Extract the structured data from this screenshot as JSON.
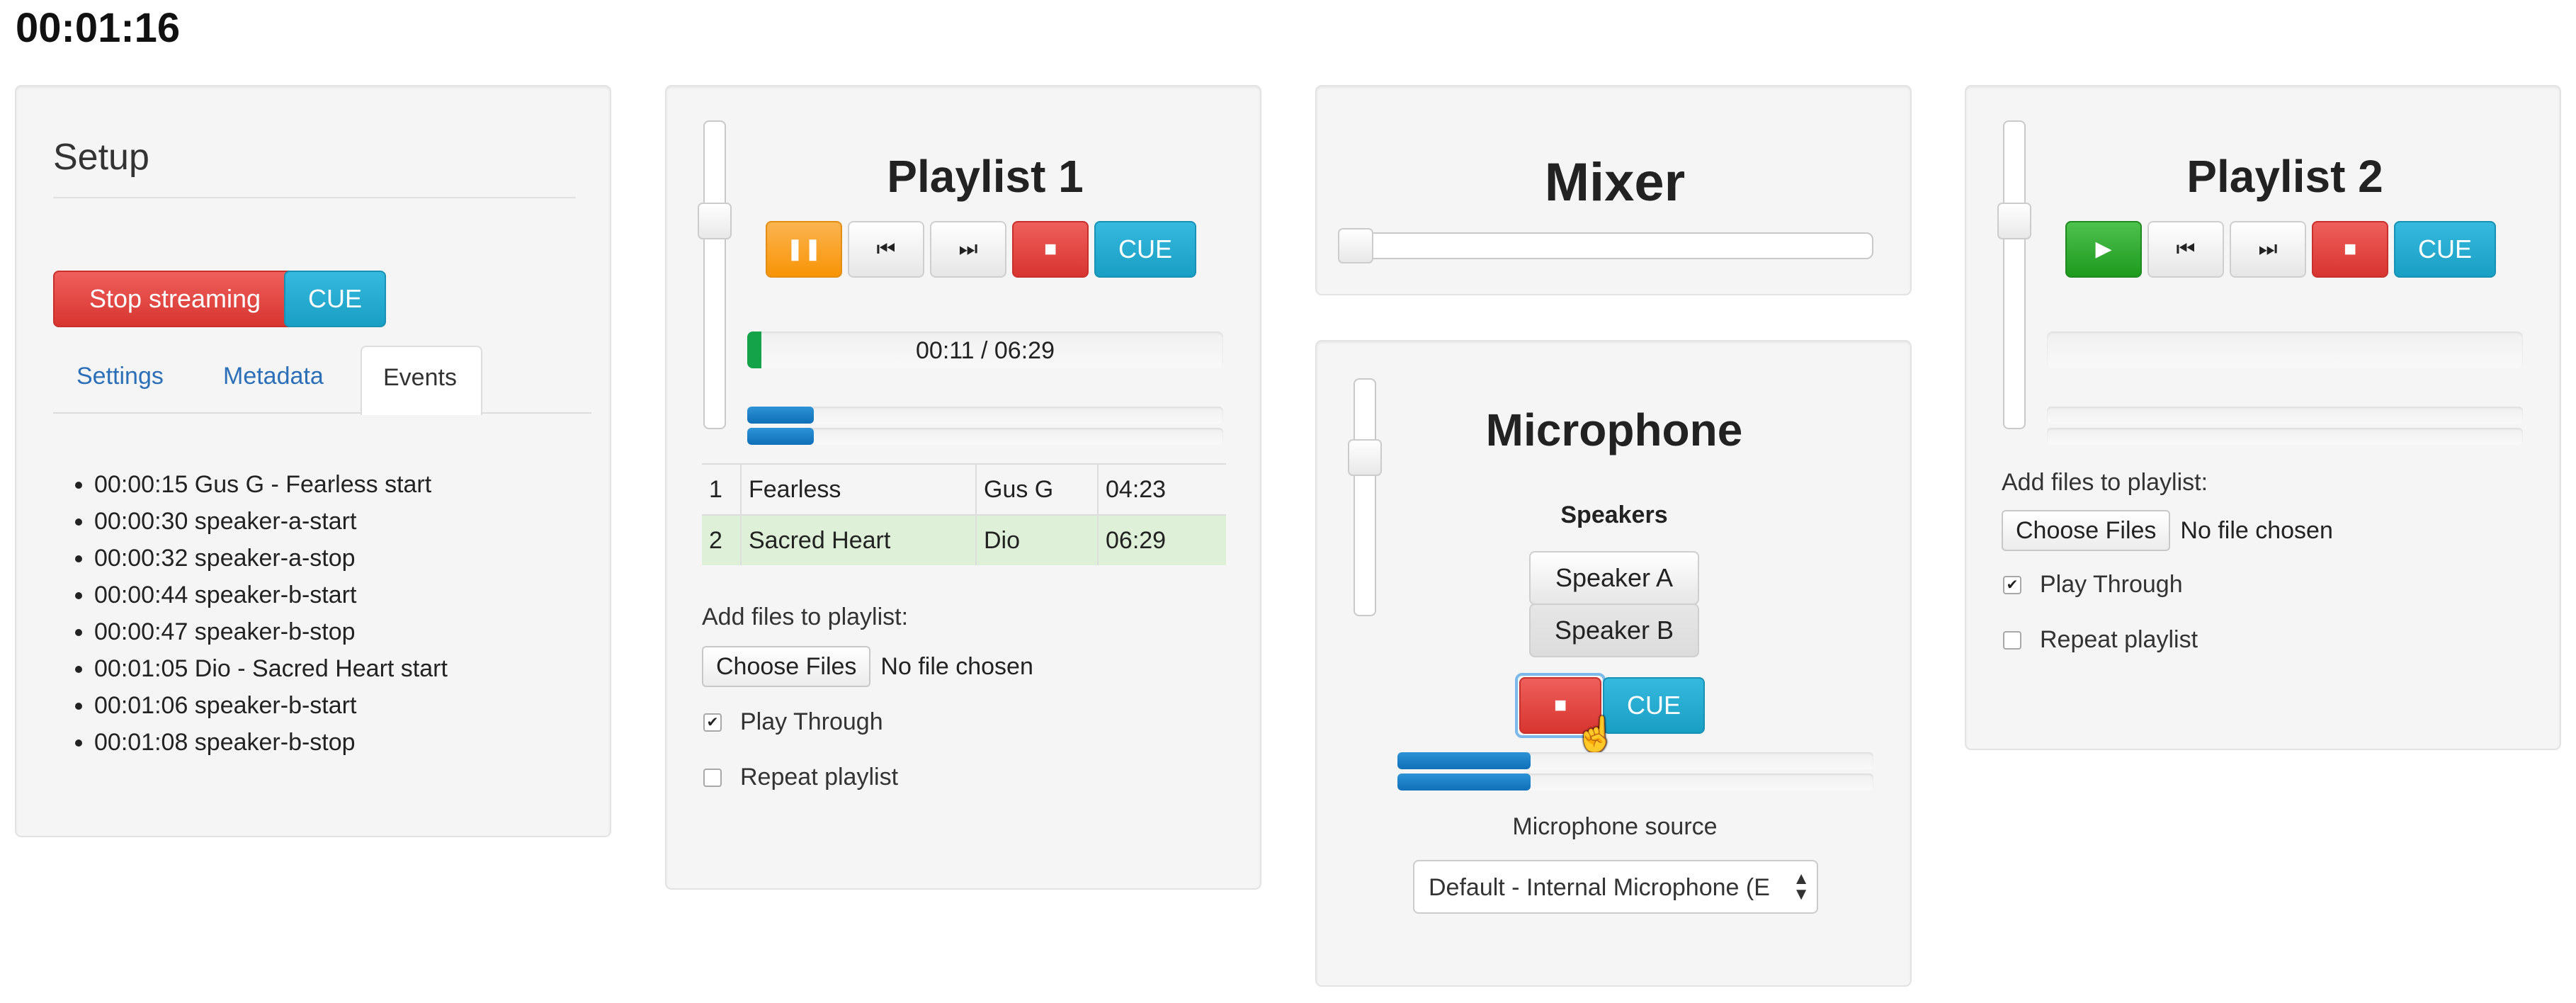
{
  "clock": "00:01:16",
  "setup": {
    "title": "Setup",
    "stop_streaming": "Stop streaming",
    "cue": "CUE",
    "tabs": [
      "Settings",
      "Metadata",
      "Events"
    ],
    "active_tab": "Events",
    "events": [
      "00:00:15 Gus G - Fearless start",
      "00:00:30 speaker-a-start",
      "00:00:32 speaker-a-stop",
      "00:00:44 speaker-b-start",
      "00:00:47 speaker-b-stop",
      "00:01:05 Dio - Sacred Heart start",
      "00:01:06 speaker-b-start",
      "00:01:08 speaker-b-stop"
    ]
  },
  "playlist1": {
    "title": "Playlist 1",
    "state": "playing",
    "cue": "CUE",
    "time": "00:11 / 06:29",
    "progress": 0.03,
    "volume_level": 0.7,
    "meters": [
      0.14,
      0.14
    ],
    "tracks": [
      {
        "n": "1",
        "title": "Fearless",
        "artist": "Gus G",
        "duration": "04:23",
        "active": false
      },
      {
        "n": "2",
        "title": "Sacred Heart",
        "artist": "Dio",
        "duration": "06:29",
        "active": true
      }
    ],
    "add_files_label": "Add files to playlist:",
    "choose_files": "Choose Files",
    "no_file": "No file chosen",
    "play_through": "Play Through",
    "play_through_checked": true,
    "repeat": "Repeat playlist",
    "repeat_checked": false
  },
  "mixer": {
    "title": "Mixer",
    "value": 0.0
  },
  "microphone": {
    "title": "Microphone",
    "speakers_label": "Speakers",
    "speaker_a": "Speaker A",
    "speaker_b": "Speaker B",
    "cue": "CUE",
    "volume_level": 0.7,
    "meters": [
      0.28,
      0.28
    ],
    "source_label": "Microphone source",
    "source_value": "Default - Internal Microphone (E"
  },
  "playlist2": {
    "title": "Playlist 2",
    "state": "stopped",
    "cue": "CUE",
    "volume_level": 0.7,
    "add_files_label": "Add files to playlist:",
    "choose_files": "Choose Files",
    "no_file": "No file chosen",
    "play_through": "Play Through",
    "play_through_checked": true,
    "repeat": "Repeat playlist",
    "repeat_checked": false
  }
}
